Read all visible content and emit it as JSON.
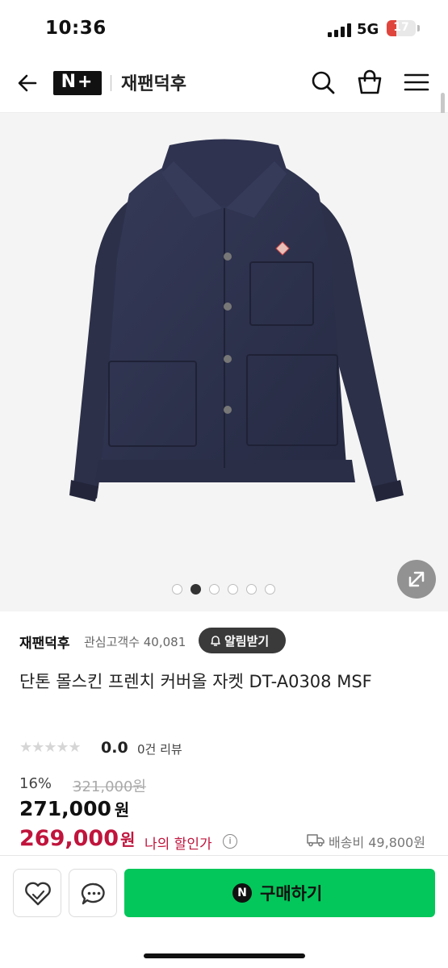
{
  "status_bar": {
    "time": "10:36",
    "network": "5G",
    "battery": "17",
    "battery_level": 0.17
  },
  "header": {
    "brand_logo": "N+",
    "store_name": "재팬덕후",
    "icons": [
      "back-arrow-icon",
      "search-icon",
      "shopping-bag-icon",
      "menu-icon"
    ]
  },
  "gallery": {
    "image": "navy-french-coverall-jacket",
    "total_images": 6,
    "active_index": 1,
    "expand_icon": "expand-icon"
  },
  "store": {
    "name": "재팬덕후",
    "fans_label": "관심고객수 40,081",
    "notify_label": "알림받기"
  },
  "product": {
    "title": "단톤 몰스킨 프렌치 커버올 자켓 DT-A0308 MSF",
    "rating": "0.0",
    "rating_max": 5,
    "reviews": "0건 리뷰",
    "discount_rate": "16%",
    "original_price": "321,000원",
    "sale_price": "271,000",
    "sale_unit": "원",
    "my_price": "269,000",
    "my_unit": "원",
    "my_price_label": "나의 할인가",
    "shipping_label": "배송비 49,800원"
  },
  "bottom_bar": {
    "buy_label": "구매하기",
    "buy_badge": "N",
    "wishlist_icon": "heart-icon",
    "chat_icon": "chat-bubble-icon"
  },
  "colors": {
    "accent_green": "#03c75a",
    "price_red": "#c0143c",
    "jacket_navy": "#2b2f4a"
  }
}
